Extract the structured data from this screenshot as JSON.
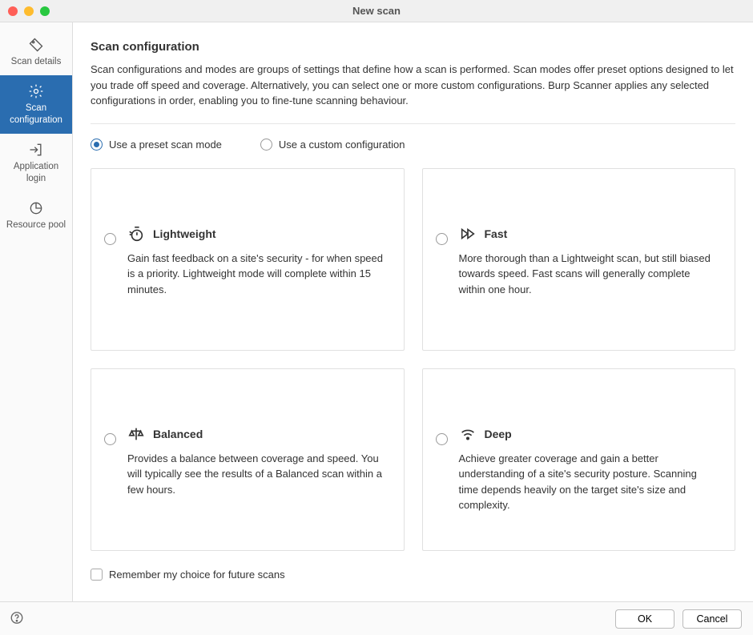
{
  "window": {
    "title": "New scan"
  },
  "sidebar": {
    "items": [
      {
        "label": "Scan details"
      },
      {
        "label": "Scan configuration"
      },
      {
        "label": "Application login"
      },
      {
        "label": "Resource pool"
      }
    ]
  },
  "section": {
    "title": "Scan configuration",
    "description": "Scan configurations and modes are groups of settings that define how a scan is performed. Scan modes offer preset options designed to let you trade off speed and coverage. Alternatively, you can select one or more custom configurations. Burp Scanner applies any selected configurations in order, enabling you to fine-tune scanning behaviour."
  },
  "mode": {
    "preset_label": "Use a preset scan mode",
    "custom_label": "Use a custom configuration",
    "selected": "preset"
  },
  "cards": [
    {
      "title": "Lightweight",
      "description": "Gain fast feedback on a site's security - for when speed is a priority. Lightweight mode will complete within 15 minutes."
    },
    {
      "title": "Fast",
      "description": "More thorough than a Lightweight scan, but still biased towards speed. Fast scans will generally complete within one hour."
    },
    {
      "title": "Balanced",
      "description": "Provides a balance between coverage and speed. You will typically see the results of a Balanced scan within a few hours."
    },
    {
      "title": "Deep",
      "description": "Achieve greater coverage and gain a better understanding of a site's security posture. Scanning time depends heavily on the target site's size and complexity."
    }
  ],
  "remember_label": "Remember my choice for future scans",
  "buttons": {
    "ok": "OK",
    "cancel": "Cancel"
  }
}
